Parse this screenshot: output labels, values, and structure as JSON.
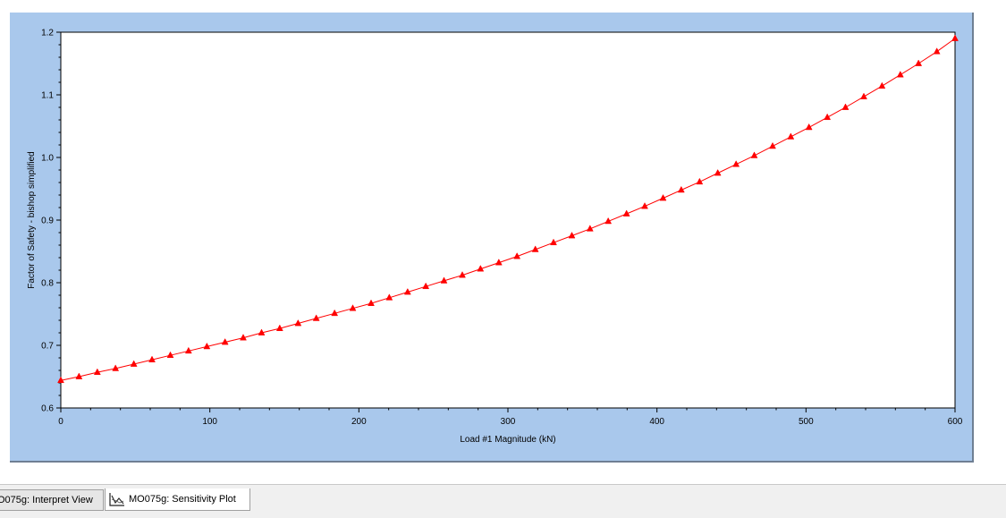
{
  "chart_data": {
    "type": "line",
    "xlabel": "Load #1 Magnitude (kN)",
    "ylabel": "Factor of Safety - bishop simplified",
    "xlim": [
      0,
      600
    ],
    "ylim": [
      0.6,
      1.2
    ],
    "xticks": [
      "0",
      "100",
      "200",
      "300",
      "400",
      "500",
      "600"
    ],
    "yticks": [
      "0.6",
      "0.7",
      "0.8",
      "0.9",
      "1.0",
      "1.1",
      "1.2"
    ],
    "grid": false,
    "series": [
      {
        "color": "#ff0000",
        "marker": "triangle",
        "x": [
          0,
          12.2,
          24.5,
          36.7,
          49,
          61.2,
          73.5,
          85.7,
          98,
          110.2,
          122.4,
          134.7,
          146.9,
          159.2,
          171.4,
          183.7,
          195.9,
          208.2,
          220.4,
          232.7,
          244.9,
          257.1,
          269.4,
          281.6,
          293.9,
          306.1,
          318.4,
          330.6,
          342.9,
          355.1,
          367.3,
          379.6,
          391.8,
          404.1,
          416.3,
          428.6,
          440.8,
          453.1,
          465.3,
          477.6,
          489.8,
          502,
          514.3,
          526.5,
          538.8,
          551,
          563.3,
          575.5,
          587.8,
          600
        ],
        "y": [
          0.644,
          0.65,
          0.657,
          0.663,
          0.67,
          0.677,
          0.684,
          0.691,
          0.698,
          0.705,
          0.712,
          0.72,
          0.727,
          0.735,
          0.743,
          0.751,
          0.759,
          0.767,
          0.776,
          0.785,
          0.794,
          0.803,
          0.812,
          0.822,
          0.832,
          0.842,
          0.853,
          0.864,
          0.875,
          0.886,
          0.898,
          0.91,
          0.922,
          0.935,
          0.948,
          0.961,
          0.975,
          0.989,
          1.003,
          1.018,
          1.033,
          1.048,
          1.064,
          1.08,
          1.097,
          1.114,
          1.132,
          1.15,
          1.169,
          1.19
        ]
      }
    ]
  },
  "tabs": {
    "interpret_label": "O075g: Interpret View",
    "sensitivity_label": "MO075g: Sensitivity Plot",
    "sensitivity_icon": "line-graph-icon"
  }
}
